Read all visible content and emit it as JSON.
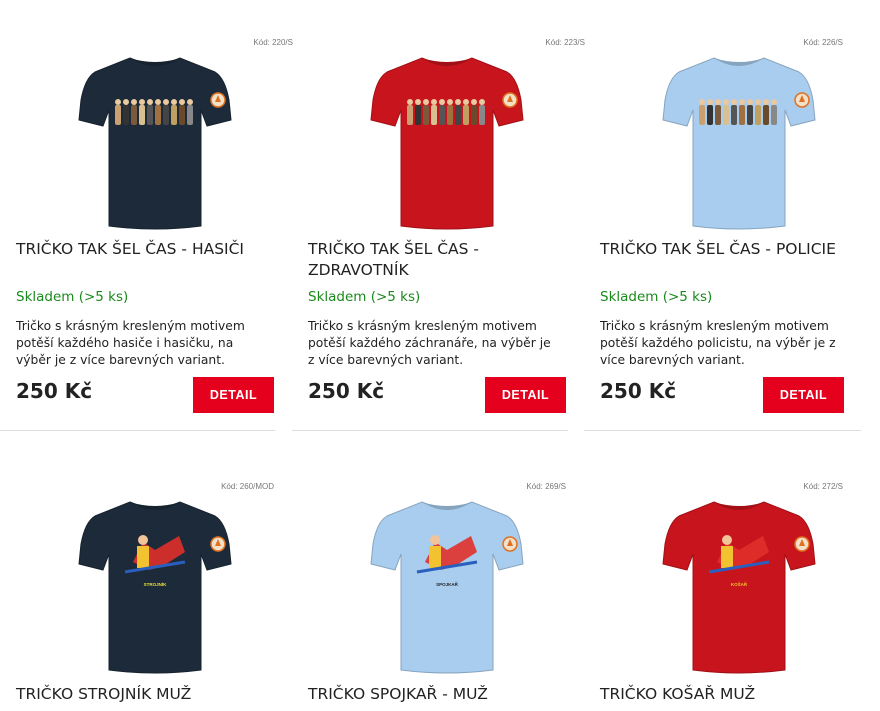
{
  "products": [
    {
      "code": "Kód: 220/S",
      "title": "TRIČKO TAK ŠEL ČAS - HASIČI",
      "stock": "Skladem (>5 ks)",
      "description": "Tričko s krásným kresleným motivem potěší každého hasiče i hasičku, na výběr je z více barevných variant.",
      "price": "250 Kč",
      "button": "DETAIL",
      "shirt_color": "#1c2a3a",
      "print_label": ""
    },
    {
      "code": "Kód: 223/S",
      "title": "TRIČKO TAK ŠEL ČAS - ZDRAVOTNÍK",
      "stock": "Skladem (>5 ks)",
      "description": "Tričko s krásným kresleným motivem potěší každého záchranáře, na výběr je z více barevných variant.",
      "price": "250 Kč",
      "button": "DETAIL",
      "shirt_color": "#c8141c",
      "print_label": ""
    },
    {
      "code": "Kód: 226/S",
      "title": "TRIČKO TAK ŠEL ČAS - POLICIE",
      "stock": "Skladem (>5 ks)",
      "description": "Tričko s krásným kresleným motivem potěší každého policistu, na výběr je z více barevných variant.",
      "price": "250 Kč",
      "button": "DETAIL",
      "shirt_color": "#a9cdee",
      "print_label": ""
    },
    {
      "code": "Kód: 260/MOD",
      "title": "TRIČKO STROJNÍK MUŽ",
      "shirt_color": "#1c2a3a",
      "print_label": "STROJNÍK"
    },
    {
      "code": "Kód: 269/S",
      "title": "TRIČKO SPOJKAŘ - MUŽ",
      "shirt_color": "#a9cdee",
      "print_label": "SPOJKAŘ"
    },
    {
      "code": "Kód: 272/S",
      "title": "TRIČKO KOŠAŘ MUŽ",
      "shirt_color": "#c8141c",
      "print_label": "KOŠAŘ"
    }
  ]
}
